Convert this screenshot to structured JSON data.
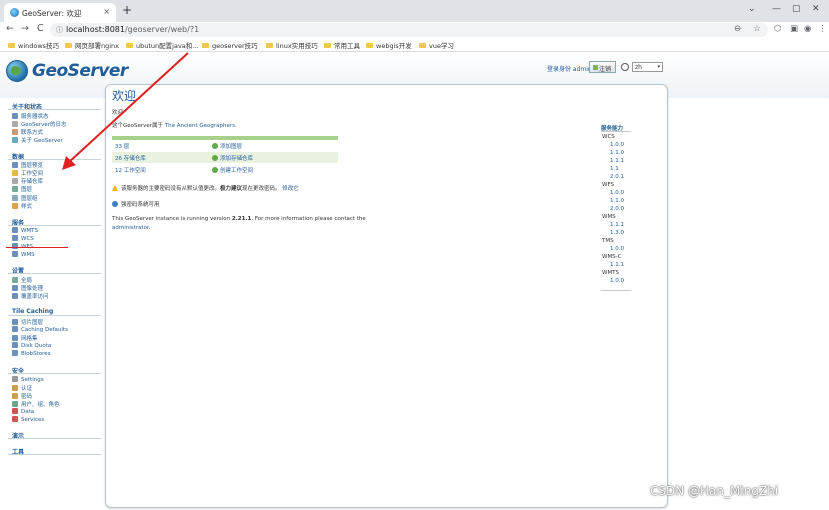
{
  "browser": {
    "tab_title": "GeoServer: 欢迎",
    "close_glyph": "×",
    "new_tab": "+",
    "win_controls": [
      "⌄",
      "—",
      "▢",
      "✕"
    ],
    "nav_back": "←",
    "nav_forward": "→",
    "nav_reload": "C",
    "url_host": "localhost:8081",
    "url_path": "/geoserver/web/?1",
    "toolbar_icons": [
      "zoom-icon",
      "star-icon",
      "extensions-icon",
      "sidepanel-icon",
      "profile-icon",
      "menu-icon"
    ]
  },
  "bookmarks": [
    "windows技巧",
    "网页部署nginx",
    "ubutun配置java和...",
    "geoserver技巧",
    "linux实用技巧",
    "常用工具",
    "webgis开发",
    "vue学习"
  ],
  "header": {
    "logo_text": "GeoServer",
    "login_text": "登录身份 admin.",
    "logout_label": "注销",
    "language": "zh",
    "language_caret": "▾"
  },
  "sidebar": {
    "sections": [
      {
        "title": "关于和状态",
        "items": [
          "服务器状态",
          "GeoServer的日志",
          "联系方式",
          "关于 GeoServer"
        ]
      },
      {
        "title": "数据",
        "items": [
          "图层预览",
          "工作空间",
          "存储仓库",
          "图层",
          "图层组",
          "样式"
        ]
      },
      {
        "title": "服务",
        "items": [
          "WMTS",
          "WCS",
          "WFS",
          "WMS"
        ]
      },
      {
        "title": "设置",
        "items": [
          "全局",
          "图像处理",
          "覆盖率访问"
        ]
      },
      {
        "title": "Tile Caching",
        "items": [
          "切片图层",
          "Caching Defaults",
          "网格集",
          "Disk Quota",
          "BlobStores"
        ]
      },
      {
        "title": "安全",
        "items": [
          "Settings",
          "认证",
          "密码",
          "用户、组、角色",
          "Data",
          "Services"
        ]
      },
      {
        "title": "演示",
        "items": []
      },
      {
        "title": "工具",
        "items": []
      }
    ]
  },
  "main": {
    "title": "欢迎",
    "welcome_text": "欢迎",
    "belongs_prefix": "这个GeoServer属于",
    "belongs_org": "The Ancient Geographers",
    "belongs_suffix": ".",
    "stats": [
      {
        "count": "33 层",
        "add": "添加图层"
      },
      {
        "count": "26 存储仓库",
        "add": "添加存储仓库"
      },
      {
        "count": "12 工作空间",
        "add": "创建工作空间"
      }
    ],
    "warning_prefix": "该服务器的主要密码没有从默认值更改。",
    "warning_bold": "极力建议",
    "warning_mid": "现在更改密码。",
    "warning_link": "修改它",
    "info_text": "强密码系统可用",
    "version_prefix": "This GeoServer instance is running version",
    "version": "2.21.1",
    "version_suffix": ". For more information please contact the",
    "admin_link": "administrator",
    "admin_suffix": "."
  },
  "capabilities": {
    "title": "服务能力",
    "services": [
      {
        "name": "WCS",
        "versions": [
          "1.0.0",
          "1.1.0",
          "1.1.1",
          "1.1",
          "2.0.1"
        ]
      },
      {
        "name": "WFS",
        "versions": [
          "1.0.0",
          "1.1.0",
          "2.0.0"
        ]
      },
      {
        "name": "WMS",
        "versions": [
          "1.1.1",
          "1.3.0"
        ]
      },
      {
        "name": "TMS",
        "versions": [
          "1.0.0"
        ]
      },
      {
        "name": "WMS-C",
        "versions": [
          "1.1.1"
        ]
      },
      {
        "name": "WMTS",
        "versions": [
          "1.0.0"
        ]
      }
    ]
  },
  "watermark": "CSDN @Han_MingZhi",
  "colors": {
    "link": "#1f5c99",
    "annotation": "#e02020",
    "stat_alt_row": "#e8f2df"
  }
}
